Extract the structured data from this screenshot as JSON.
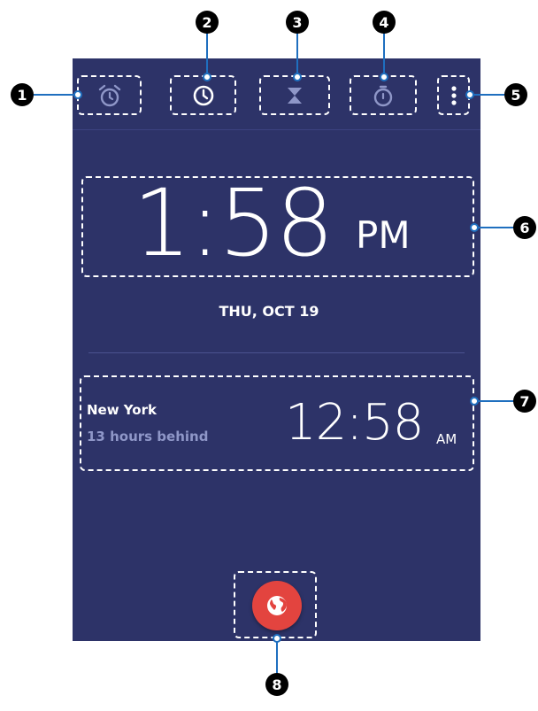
{
  "tabs": [
    {
      "icon": "alarm-icon"
    },
    {
      "icon": "clock-icon"
    },
    {
      "icon": "hourglass-icon"
    },
    {
      "icon": "stopwatch-icon"
    },
    {
      "icon": "more-vert-icon"
    }
  ],
  "clock": {
    "time": "1:58",
    "ampm": "PM",
    "date": "THU, OCT 19"
  },
  "world_clock": {
    "city": "New York",
    "difference": "13 hours behind",
    "time": "12:58",
    "ampm": "AM"
  },
  "fab": {
    "icon": "globe-icon"
  },
  "callouts": [
    "1",
    "2",
    "3",
    "4",
    "5",
    "6",
    "7",
    "8"
  ],
  "colors": {
    "background": "#2d3368",
    "fab": "#e3443f",
    "leader": "#1f6fbf",
    "secondary_text": "#8f97c8"
  }
}
